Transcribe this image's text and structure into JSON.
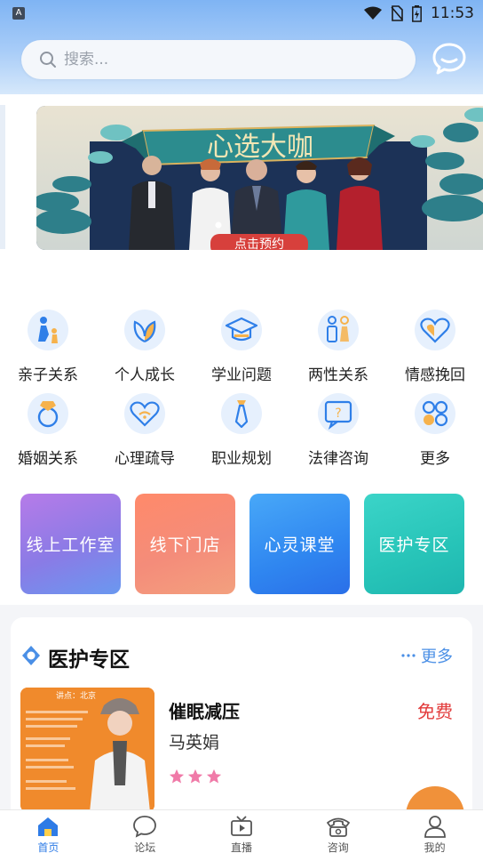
{
  "status_bar": {
    "app_badge": "A",
    "time": "11:53"
  },
  "search": {
    "placeholder": "搜索..."
  },
  "banner": {
    "headline": "心选大咖",
    "cta": "点击预约"
  },
  "categories": [
    {
      "label": "亲子关系",
      "icon": "parent-child-icon"
    },
    {
      "label": "个人成长",
      "icon": "leaf-growth-icon"
    },
    {
      "label": "学业问题",
      "icon": "graduation-cap-icon"
    },
    {
      "label": "两性关系",
      "icon": "couple-icon"
    },
    {
      "label": "情感挽回",
      "icon": "hearts-icon"
    },
    {
      "label": "婚姻关系",
      "icon": "ring-icon"
    },
    {
      "label": "心理疏导",
      "icon": "heart-chat-icon"
    },
    {
      "label": "职业规划",
      "icon": "tie-icon"
    },
    {
      "label": "法律咨询",
      "icon": "question-bubble-icon"
    },
    {
      "label": "更多",
      "icon": "grid-more-icon"
    }
  ],
  "feature_cards": [
    {
      "label": "线上工作室"
    },
    {
      "label": "线下门店"
    },
    {
      "label": "心灵课堂"
    },
    {
      "label": "医护专区"
    }
  ],
  "medical_section": {
    "title": "医护专区",
    "more_label": "更多",
    "course": {
      "title": "催眠减压",
      "teacher": "马英娟",
      "price": "免费",
      "rating_stars": 3,
      "image_tag": "讲点：北京"
    }
  },
  "bottom_nav": [
    {
      "label": "首页",
      "icon": "home-icon",
      "active": true
    },
    {
      "label": "论坛",
      "icon": "forum-bubble-icon",
      "active": false
    },
    {
      "label": "直播",
      "icon": "tv-icon",
      "active": false
    },
    {
      "label": "咨询",
      "icon": "phone-icon",
      "active": false
    },
    {
      "label": "我的",
      "icon": "profile-icon",
      "active": false
    }
  ],
  "colors": {
    "accent": "#2e7be6",
    "price_red": "#e23b3b",
    "star_pink": "#f07aa8",
    "card_online": "#9a7ee6",
    "card_offline": "#f28a72",
    "card_class": "#2f86f0",
    "card_medical": "#27c4b8"
  }
}
